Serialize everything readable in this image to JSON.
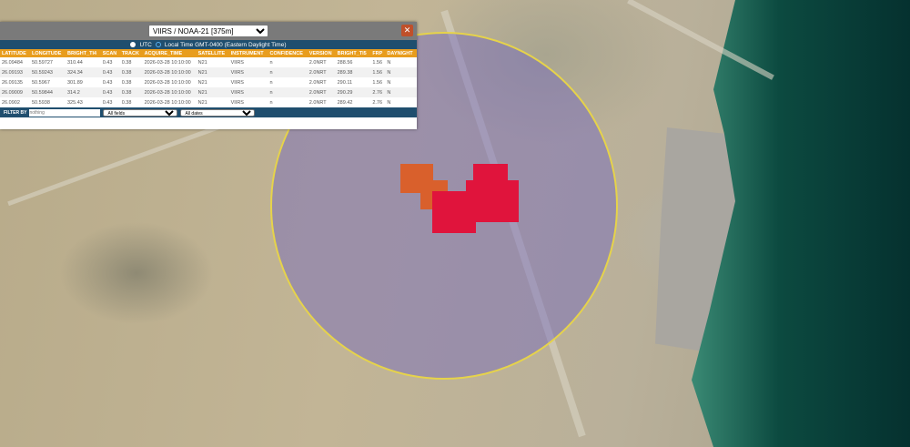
{
  "panel": {
    "dataset": "VIIRS / NOAA-21 [375m]",
    "close": "✕",
    "time_utc": "UTC",
    "time_local": "Local Time GMT-0400 (Eastern Daylight Time)",
    "columns": [
      "LATITUDE",
      "LONGITUDE",
      "BRIGHT_TI4",
      "SCAN",
      "TRACK",
      "ACQUIRE_TIME",
      "SATELLITE",
      "INSTRUMENT",
      "CONFIDENCE",
      "VERSION",
      "BRIGHT_TI5",
      "FRP",
      "DAYNIGHT"
    ],
    "rows": [
      [
        "26.09484",
        "50.59727",
        "310.44",
        "0.43",
        "0.38",
        "2026-03-28 10:10:00",
        "N21",
        "VIIRS",
        "n",
        "2.0NRT",
        "288.56",
        "1.56",
        "N"
      ],
      [
        "26.09193",
        "50.59243",
        "324.34",
        "0.43",
        "0.38",
        "2026-03-28 10:10:00",
        "N21",
        "VIIRS",
        "n",
        "2.0NRT",
        "289.38",
        "1.56",
        "N"
      ],
      [
        "26.09135",
        "50.5967",
        "301.89",
        "0.43",
        "0.38",
        "2026-03-28 10:10:00",
        "N21",
        "VIIRS",
        "n",
        "2.0NRT",
        "290.11",
        "1.56",
        "N"
      ],
      [
        "26.09009",
        "50.59844",
        "314.2",
        "0.43",
        "0.38",
        "2026-03-28 10:10:00",
        "N21",
        "VIIRS",
        "n",
        "2.0NRT",
        "290.29",
        "2.76",
        "N"
      ],
      [
        "26.0902",
        "50.5938",
        "325.43",
        "0.43",
        "0.38",
        "2026-03-28 10:10:00",
        "N21",
        "VIIRS",
        "n",
        "2.0NRT",
        "289.42",
        "2.76",
        "N"
      ]
    ],
    "filter_label": "FILTER BY",
    "filter_placeholder": "nothing",
    "field_select": "All fields",
    "date_select": "All dates"
  },
  "colors": {
    "fire_high": "#e0143c",
    "fire_mid": "#d9602c",
    "aoi": "#e6d34a"
  }
}
